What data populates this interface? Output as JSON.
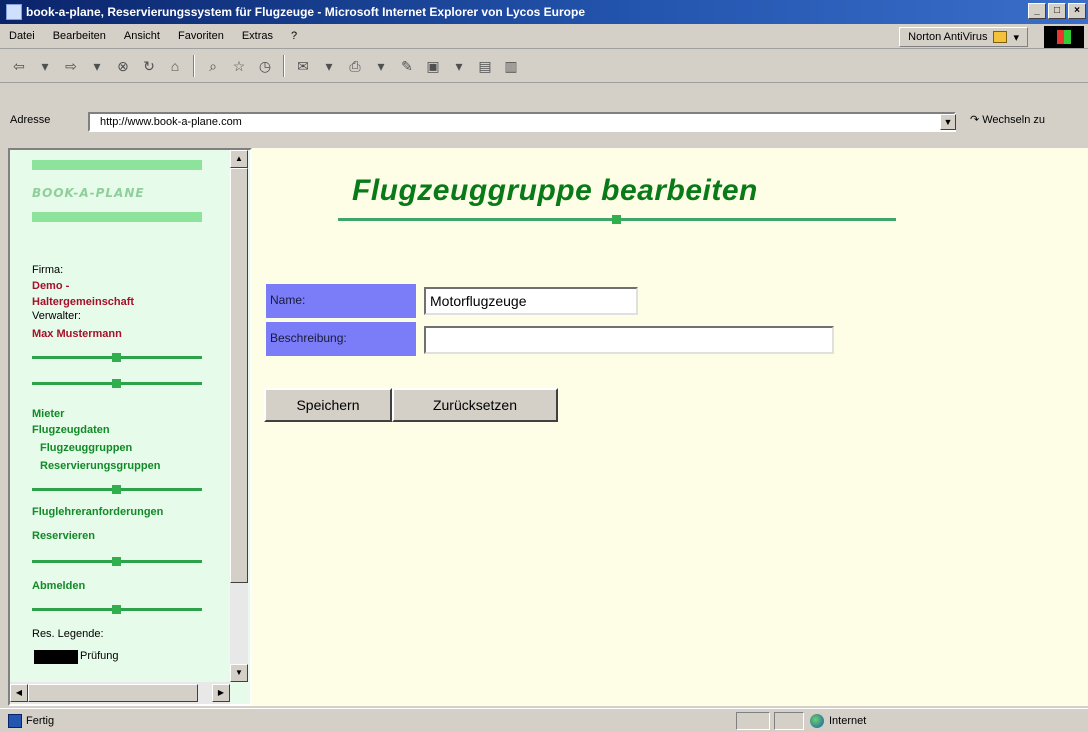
{
  "window": {
    "title": "book-a-plane, Reservierungssystem für Flugzeuge - Microsoft Internet Explorer von Lycos Europe",
    "min": "_",
    "max": "□",
    "close": "×"
  },
  "menu": {
    "items": [
      "Datei",
      "Bearbeiten",
      "Ansicht",
      "Favoriten",
      "Extras",
      "?"
    ],
    "norton": "Norton AntiVirus"
  },
  "address": {
    "label": "Adresse",
    "url": "http://www.book-a-plane.com",
    "go": "Wechseln zu"
  },
  "sidebar": {
    "logo": "BOOK-A-PLANE",
    "firma_label": "Firma:",
    "firma_value": "Demo - Haltergemeinschaft",
    "firma_line1": "Demo -",
    "firma_line2": "Haltergemeinschaft",
    "verwalter_label": "Verwalter:",
    "verwalter_value": "Max Mustermann",
    "links": {
      "mieter": "Mieter",
      "flugzeugdaten": "Flugzeugdaten",
      "flugzeuggruppen": "Flugzeuggruppen",
      "reservierungsgruppen": "Reservierungsgruppen",
      "fluglehrer": "Fluglehreranforderungen",
      "reservieren": "Reservieren",
      "abmelden": "Abmelden"
    },
    "legend_label": "Res. Legende:",
    "legend_item": "Prüfung"
  },
  "main": {
    "heading": "Flugzeuggruppe bearbeiten",
    "name_label": "Name:",
    "name_value": "Motorflugzeuge",
    "description_label": "Beschreibung:",
    "description_value": "",
    "save_button": "Speichern",
    "reset_button": "Zurücksetzen"
  },
  "status": {
    "text": "Fertig",
    "zone": "Internet"
  },
  "colors": {
    "sidebar_bg": "#e6fbea",
    "content_bg": "#fefee6",
    "heading": "#087a18",
    "label_bg": "#7a7df7",
    "link": "#128a27",
    "accent_red": "#a5102a"
  }
}
